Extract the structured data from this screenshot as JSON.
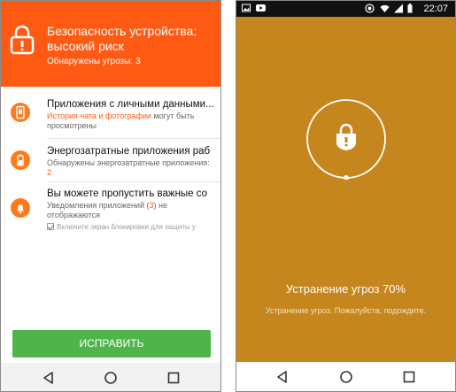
{
  "left_screen": {
    "header": {
      "title": "Безопасность устройства: высокий риск",
      "threats_label": "Обнаружены угрозы:",
      "threats_count": "3",
      "color": "#ff5a13"
    },
    "issues": [
      {
        "title": "Приложения с личными данными...",
        "desc_highlight": "История чата и фотографии",
        "desc_rest": " могут быть просмотрены",
        "icon": "phone-lock-icon"
      },
      {
        "title": "Энергозатратные приложения раб",
        "desc_prefix": "Обнаружены энергозатратные приложения: ",
        "desc_count": "2",
        "icon": "battery-icon"
      },
      {
        "title": "Вы можете пропустить важные со",
        "desc_prefix": "Уведомления приложений (",
        "desc_count": "3",
        "desc_suffix": ") не отображаются",
        "checkbox_label": "Включите экран блокировки для защиты у",
        "icon": "bell-icon"
      }
    ],
    "fix_button": "ИСПРАВИТЬ",
    "accent_green": "#4fb54a"
  },
  "right_screen": {
    "status_time": "22:07",
    "cleaning_title": "Устранение угроз 70%",
    "cleaning_progress": 0.7,
    "cleaning_sub": "Устранение угроз. Пожалуйста, подождите.",
    "background": "#c5861e"
  }
}
